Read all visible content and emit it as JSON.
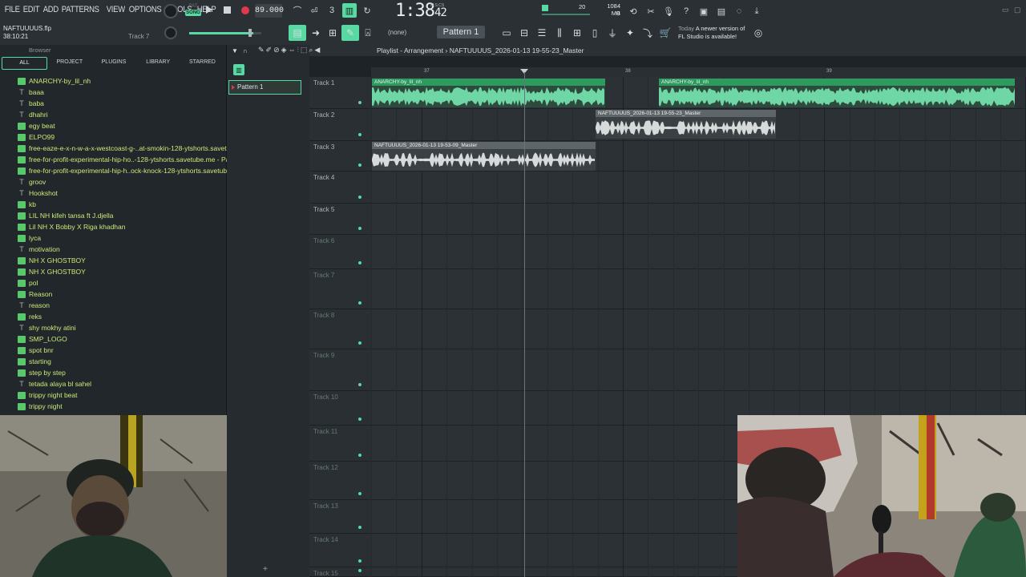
{
  "menu": [
    "FILE",
    "EDIT",
    "ADD",
    "PATTERNS",
    "VIEW",
    "OPTIONS",
    "TOOLS",
    "HELP"
  ],
  "project": {
    "file": "NAFTUUUUS.flp",
    "time": "38:10:21",
    "hint": "Track 7"
  },
  "transport": {
    "mode_pat": "PAT",
    "mode_song": "SONG",
    "tempo": "89.000",
    "time_main": "1:38",
    "time_sub": "42",
    "time_label": "M:S:CS"
  },
  "monitor": {
    "cpu": "20",
    "mem": "1084 MB",
    "poly": "0"
  },
  "toolbar2": {
    "snap": "(none)",
    "pattern": "Pattern 1"
  },
  "news": {
    "today": "Today",
    "line1": "A newer version of",
    "line2": "FL Studio is available!"
  },
  "browser": {
    "title": "Browser",
    "tabs": [
      "ALL",
      "PROJECT",
      "PLUGINS",
      "LIBRARY",
      "STARRED"
    ],
    "items": [
      {
        "name": "ANARCHY-by_lil_nh",
        "type": "audio"
      },
      {
        "name": "baaa",
        "type": "text"
      },
      {
        "name": "baba",
        "type": "text"
      },
      {
        "name": "dhahri",
        "type": "text"
      },
      {
        "name": "egy beat",
        "type": "audio"
      },
      {
        "name": "ELPO99",
        "type": "audio"
      },
      {
        "name": "free-eaze-e-x-n-w-a-x-westcoast-g-..at-smokin-128-ytshorts.savetube.me",
        "type": "audio"
      },
      {
        "name": "free-for-profit-experimental-hip-ho..-128-ytshorts.savetube.me - Part_2",
        "type": "audio"
      },
      {
        "name": "free-for-profit-experimental-hip-h..ock-knock-128-ytshorts.savetube.me",
        "type": "audio"
      },
      {
        "name": "groov",
        "type": "text"
      },
      {
        "name": "Hookshot",
        "type": "text"
      },
      {
        "name": "kb",
        "type": "audio"
      },
      {
        "name": "LIL NH kifeh tansa ft J.djella",
        "type": "audio"
      },
      {
        "name": "Lil NH X Bobby X Riga khadhan",
        "type": "audio"
      },
      {
        "name": "lyca",
        "type": "audio"
      },
      {
        "name": "motivation",
        "type": "text"
      },
      {
        "name": "NH X GHOSTBOY",
        "type": "audio"
      },
      {
        "name": "NH X GHOSTBOY",
        "type": "audio"
      },
      {
        "name": "pol",
        "type": "audio"
      },
      {
        "name": "Reason",
        "type": "audio"
      },
      {
        "name": "reason",
        "type": "text"
      },
      {
        "name": "reks",
        "type": "audio"
      },
      {
        "name": "shy mokhy atini",
        "type": "text"
      },
      {
        "name": "SMP_LOGO",
        "type": "audio"
      },
      {
        "name": "spot bnr",
        "type": "audio"
      },
      {
        "name": "starting",
        "type": "audio"
      },
      {
        "name": "step by step",
        "type": "audio"
      },
      {
        "name": "tetada alaya bl sahel",
        "type": "text"
      },
      {
        "name": "trippy night beat",
        "type": "audio"
      },
      {
        "name": "trippy night",
        "type": "audio"
      }
    ]
  },
  "pattern_list": {
    "selected": "Pattern 1"
  },
  "playlist": {
    "title": "Playlist - Arrangement",
    "arrangement": "NAFTUUUUS_2026-01-13 19-55-23_Master",
    "bars": [
      "37",
      "38",
      "39"
    ],
    "tracks": [
      "Track 1",
      "Track 2",
      "Track 3",
      "Track 4",
      "Track 5",
      "Track 6",
      "Track 7",
      "Track 8",
      "Track 9",
      "Track 10",
      "Track 11",
      "Track 12",
      "Track 13",
      "Track 14",
      "Track 15"
    ],
    "clips": [
      {
        "track": 0,
        "label": "ANARCHY-by_lil_nh",
        "color": "green"
      },
      {
        "track": 0,
        "label": "ANARCHY-by_lil_nh",
        "color": "green"
      },
      {
        "track": 1,
        "label": "NAFTUUUUS_2026-01-13 19-55-23_Master",
        "color": "gray"
      },
      {
        "track": 2,
        "label": "NAFTUUUUS_2026-01-13 19-53-09_Master",
        "color": "gray"
      }
    ]
  },
  "colors": {
    "accent": "#58d8a2",
    "record": "#e2384c",
    "clip_green": "#2d9a5e",
    "clip_gray": "#5f666a"
  }
}
